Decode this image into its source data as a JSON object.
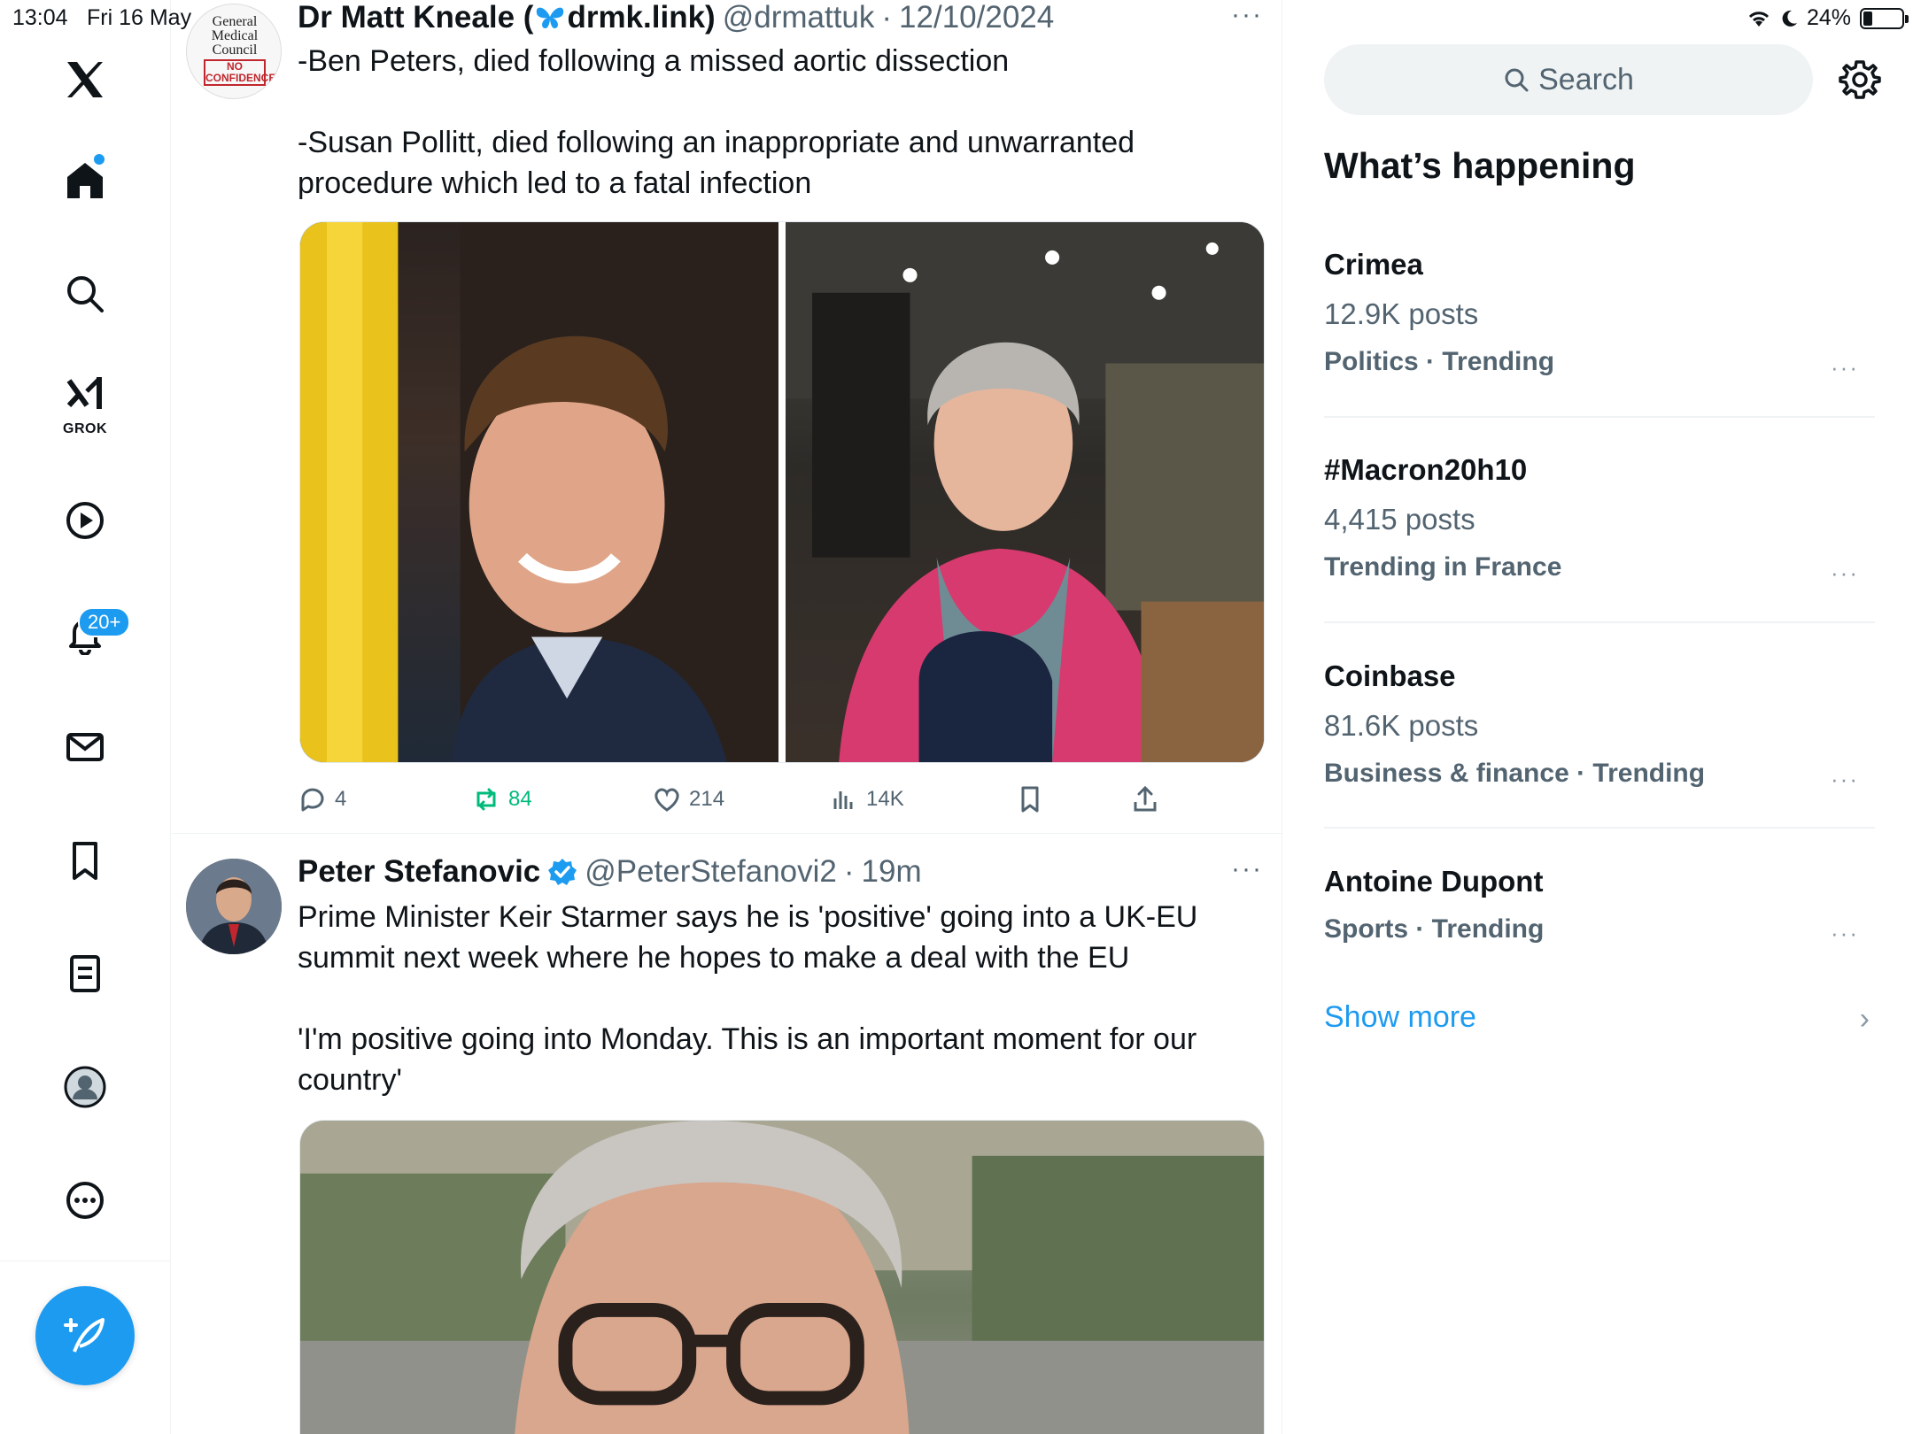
{
  "status_bar": {
    "time": "13:04",
    "date": "Fri 16 May",
    "battery": "24%",
    "battery_level": 0.24
  },
  "nav": {
    "grok_label": "GROK",
    "notifications_badge": "20+",
    "items": [
      "x-logo",
      "home-icon",
      "search-icon",
      "grok-icon",
      "video-icon",
      "notifications-icon",
      "messages-icon",
      "bookmarks-icon",
      "lists-icon",
      "profile-icon",
      "more-icon"
    ]
  },
  "tweets": [
    {
      "author": "Dr Matt Kneale (",
      "author_link": "drmk.link)",
      "handle": "@drmattuk",
      "separator": "·",
      "date": "12/10/2024",
      "more": "···",
      "avatar_text": [
        "General",
        "Medical",
        "Council"
      ],
      "avatar_badge": "NO CONFIDENCE",
      "text": "-Ben Peters, died following a missed aortic dissection\n\n-Susan Pollitt, died following an inappropriate and unwarranted procedure which led to a fatal infection",
      "replies": "4",
      "reposts": "84",
      "likes": "214",
      "views": "14K"
    },
    {
      "author": "Peter Stefanovic",
      "handle": "@PeterStefanovi2",
      "separator": "·",
      "time": "19m",
      "more": "···",
      "text": "Prime Minister Keir Starmer says he is 'positive' going into a UK-EU summit next week where he hopes to make a deal with the EU\n\n'I'm positive going into Monday. This is an important moment for our country'"
    }
  ],
  "sidebar": {
    "search_placeholder": "Search",
    "section_title": "What’s happening",
    "trends": [
      {
        "topic": "Crimea",
        "posts": "12.9K posts",
        "context": "Politics · Trending"
      },
      {
        "topic": "#Macron20h10",
        "posts": "4,415 posts",
        "context": "Trending in France"
      },
      {
        "topic": "Coinbase",
        "posts": "81.6K posts",
        "context": "Business & finance · Trending"
      },
      {
        "topic": "Antoine Dupont",
        "posts": "",
        "context": "Sports · Trending"
      }
    ],
    "trend_more": "···",
    "show_more": "Show more",
    "show_more_chevron": "›"
  },
  "colors": {
    "accent": "#1d9bf0",
    "secondary_text": "#536471",
    "repost_green": "#00ba7c"
  }
}
